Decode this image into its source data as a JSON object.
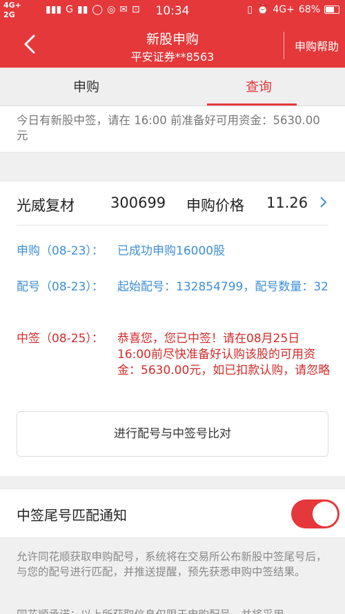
{
  "status_bar": {
    "net1": "4G+",
    "net2": "2G",
    "net3": "G",
    "time": "10:34",
    "net_right": "4G+",
    "battery": "68%",
    "battery_level": 0.68
  },
  "nav": {
    "title": "新股申购",
    "subtitle": "平安证券**8563",
    "help": "申购帮助"
  },
  "tabs": [
    {
      "label": "申购"
    },
    {
      "label": "查询"
    }
  ],
  "active_tab": "查询",
  "notice": "今日有新股中签，请在 16:00 前准备好可用资金：5630.00元",
  "stock": {
    "name": "光威复材",
    "code": "300699",
    "price_label": "申购价格",
    "price": "11.26"
  },
  "records": [
    {
      "label": "申购（08-23）：",
      "value": "已成功申购16000股"
    },
    {
      "label": "配号（08-23）：",
      "value": "起始配号：132854799，配号数量：32"
    },
    {
      "label": "中签（08-25）：",
      "value": "恭喜您，您已中签！请在08月25日16:00前尽快准备好认购该股的可用资金：5630.00元，如已扣款认购，请忽略"
    }
  ],
  "compare_button": "进行配号与中签号比对",
  "notify": {
    "label": "中签尾号匹配通知",
    "enabled": true
  },
  "description": "允许同花顺获取申购配号，系统将在交易所公布新股中签尾号后，与您的配号进行匹配，并推送提醒，预先获悉申购中签结果。",
  "description2": "同花顺承诺：以上所获取信息仅限于申购配号，并将采用",
  "colors": {
    "brand_red": "#e5383b",
    "link_blue": "#3e8fd6",
    "alert_red": "#d42a2a"
  }
}
